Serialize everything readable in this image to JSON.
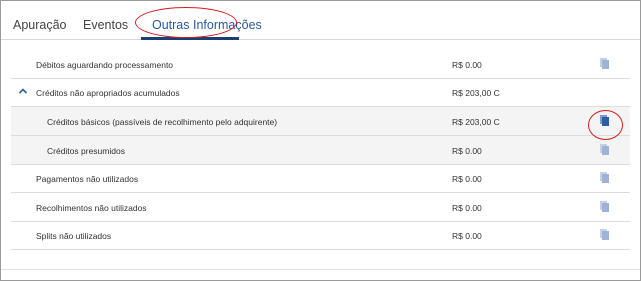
{
  "tabs": [
    {
      "label": "Apuração"
    },
    {
      "label": "Eventos"
    },
    {
      "label": "Outras Informações"
    }
  ],
  "active_tab": "Outras Informações",
  "rows": [
    {
      "label": "Débitos aguardando processamento",
      "value": "R$ 0.00"
    },
    {
      "label": "Créditos não apropriados acumulados",
      "value": "R$ 203,00 C",
      "expanded": true
    },
    {
      "label": "Créditos básicos (passíveis de recolhimento pelo adquirente)",
      "value": "R$ 203,00 C"
    },
    {
      "label": "Créditos presumidos",
      "value": "R$ 0.00"
    },
    {
      "label": "Pagamentos não utilizados",
      "value": "R$ 0.00"
    },
    {
      "label": "Recolhimentos não utilizados",
      "value": "R$ 0.00"
    },
    {
      "label": "Splits não utilizados",
      "value": "R$ 0.00"
    }
  ],
  "icons": {
    "document": "document-icon",
    "expand": "chevron-up-icon"
  },
  "colors": {
    "accent": "#1c3f72",
    "active_tab_text": "#2a5a9e",
    "annotation": "#d81d1d",
    "doc_icon_light": "#9fb3d6",
    "doc_icon_dark": "#2b5ea6"
  }
}
